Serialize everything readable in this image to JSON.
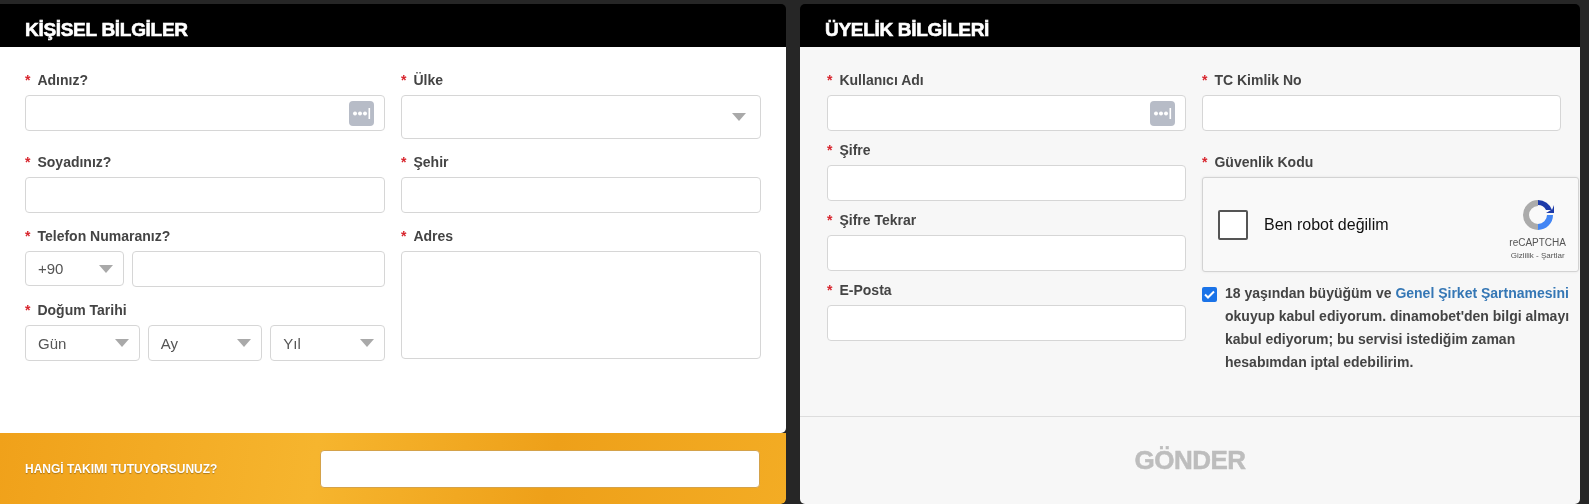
{
  "personal": {
    "title": "KİŞİSEL BİLGİLER",
    "fields": [
      {
        "kind": "text",
        "required_mark": "*",
        "label": "Adınız?",
        "autofill": true
      },
      {
        "kind": "select",
        "required_mark": "*",
        "label": "Ülke"
      },
      {
        "kind": "text",
        "required_mark": "*",
        "label": "Soyadınız?",
        "autofill": false
      },
      {
        "kind": "text",
        "required_mark": "*",
        "label": "Şehir",
        "autofill": false
      },
      {
        "kind": "phone",
        "required_mark": "*",
        "label": "Telefon Numaranız?",
        "code": "+90"
      },
      {
        "kind": "textarea",
        "required_mark": "*",
        "label": "Adres"
      },
      {
        "kind": "date",
        "required_mark": "*",
        "label": "Doğum Tarihi",
        "parts": [
          "Gün",
          "Ay",
          "Yıl"
        ]
      }
    ]
  },
  "team": {
    "label": "HANGİ TAKIMI TUTUYORSUNUZ?"
  },
  "membership": {
    "title": "ÜYELİK BİLGİLERİ",
    "columns": [
      [
        {
          "kind": "text",
          "required_mark": "*",
          "label": "Kullanıcı Adı",
          "autofill": true
        },
        {
          "kind": "text",
          "required_mark": "*",
          "label": "Şifre",
          "autofill": false
        },
        {
          "kind": "text",
          "required_mark": "*",
          "label": "Şifre Tekrar",
          "autofill": false
        },
        {
          "kind": "text",
          "required_mark": "*",
          "label": "E-Posta",
          "autofill": false
        }
      ],
      [
        {
          "kind": "text",
          "required_mark": "*",
          "label": "TC Kimlik No",
          "autofill": false
        },
        {
          "kind": "captcha",
          "required_mark": "*",
          "label": "Güvenlik Kodu",
          "prompt": "Ben robot değilim",
          "checked": false,
          "brand": "reCAPTCHA",
          "privacy": "Gizlilik",
          "separator": "-",
          "terms": "Şartlar"
        }
      ]
    ],
    "consent": {
      "checked": true,
      "text_before": "18 yaşından büyüğüm ve ",
      "link": "Genel Şirket Şartnamesini",
      "text_after": " okuyup kabul ediyorum. dinamobet'den bilgi almayı kabul ediyorum; bu servisi istediğim zaman hesabımdan iptal edebilirim."
    },
    "submit": {
      "label": "GÖNDER",
      "disabled": true
    }
  }
}
